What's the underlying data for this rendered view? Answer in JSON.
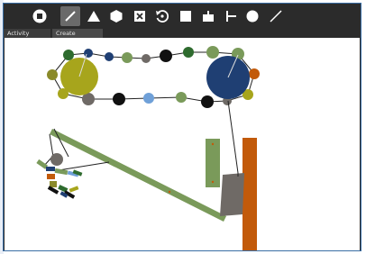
{
  "tabs": [
    {
      "label": "Activity"
    },
    {
      "label": "Create"
    }
  ],
  "toolbar": {
    "tools": [
      {
        "name": "stop-icon"
      },
      {
        "name": "pencil-icon",
        "active": true
      },
      {
        "name": "triangle-icon"
      },
      {
        "name": "hexagon-icon"
      },
      {
        "name": "delete-box-icon"
      },
      {
        "name": "rotate-icon"
      },
      {
        "name": "square-icon"
      },
      {
        "name": "motor-icon"
      },
      {
        "name": "pin-joint-icon"
      },
      {
        "name": "circle-icon"
      },
      {
        "name": "line-icon"
      }
    ]
  },
  "colors": {
    "frame": "#2b2b2b",
    "canvas": "#ffffff",
    "olive": "#a7a51c",
    "navy": "#1f3f73",
    "plank": "#7a9a5a",
    "orange": "#c25a0a",
    "gray_block": "#6f6a66"
  }
}
